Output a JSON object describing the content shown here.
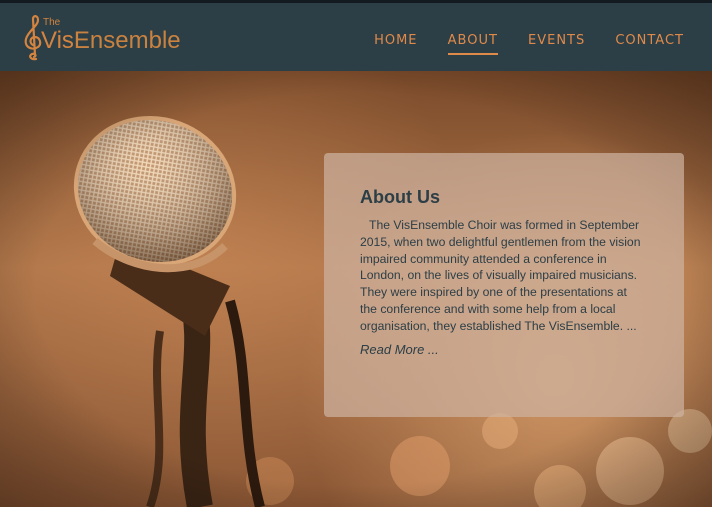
{
  "brand": {
    "small": "The",
    "vis": "Vis",
    "ensemble": "Ensemble",
    "color": "#d4843f"
  },
  "nav": {
    "items": [
      {
        "label": "HOME",
        "active": false
      },
      {
        "label": "ABOUT",
        "active": true
      },
      {
        "label": "EVENTS",
        "active": false
      },
      {
        "label": "CONTACT",
        "active": false
      }
    ],
    "color": "#e08a4a"
  },
  "hero": {
    "image": "microphone-photo"
  },
  "about": {
    "title": "About Us",
    "body": "The VisEnsemble Choir was formed in September 2015, when two delightful gentlemen from the vision impaired community attended a conference in London, on the lives of visually impaired musicians. They were inspired by one of the presentations at the conference and with some help from a local organisation, they established The VisEnsemble. ...",
    "read_more": "Read More ..."
  },
  "colors": {
    "header_bg": "#2c3e46",
    "text_dark": "#2c3e46"
  }
}
